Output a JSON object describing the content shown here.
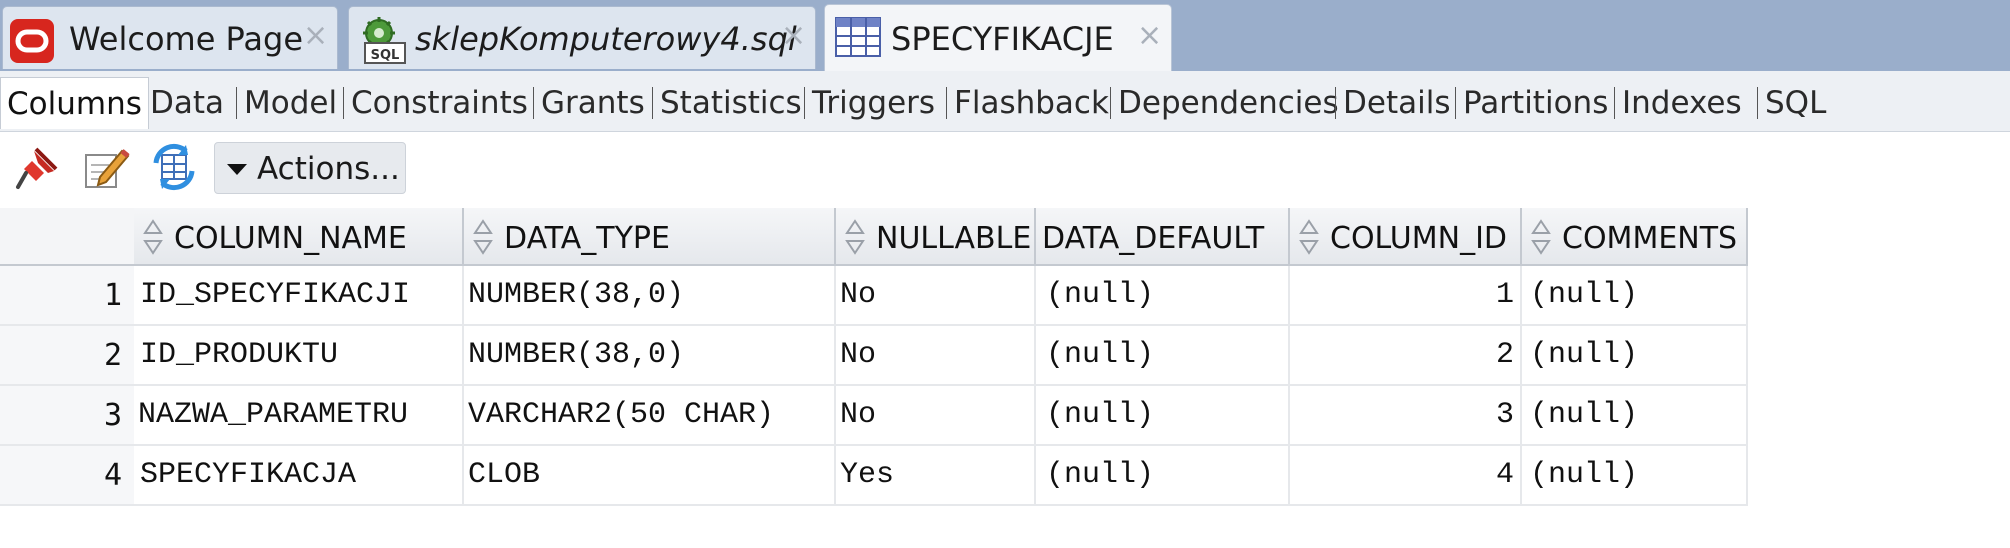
{
  "tabs": [
    {
      "label": "Welcome Page",
      "icon": "oracle-logo-icon",
      "italic": false
    },
    {
      "label": "sklepKomputerowy4.sql",
      "icon": "sql-file-icon",
      "italic": true
    },
    {
      "label": "SPECYFIKACJE",
      "icon": "table-icon",
      "italic": false,
      "active": true
    }
  ],
  "tab_close_glyph": "×",
  "subtabs": [
    "Columns",
    "Data",
    "Model",
    "Constraints",
    "Grants",
    "Statistics",
    "Triggers",
    "Flashback",
    "Dependencies",
    "Details",
    "Partitions",
    "Indexes",
    "SQL"
  ],
  "active_subtab": "Columns",
  "toolbar": {
    "icons": [
      "pin-icon",
      "edit-icon",
      "refresh-icon"
    ],
    "actions_label": "Actions..."
  },
  "grid": {
    "columns": [
      "COLUMN_NAME",
      "DATA_TYPE",
      "NULLABLE",
      "DATA_DEFAULT",
      "COLUMN_ID",
      "COMMENTS"
    ],
    "rows": [
      {
        "num": "1",
        "COLUMN_NAME": "ID_SPECYFIKACJI",
        "DATA_TYPE": "NUMBER(38,0)",
        "NULLABLE": "No",
        "DATA_DEFAULT": "(null)",
        "COLUMN_ID": "1",
        "COMMENTS": "(null)"
      },
      {
        "num": "2",
        "COLUMN_NAME": "ID_PRODUKTU",
        "DATA_TYPE": "NUMBER(38,0)",
        "NULLABLE": "No",
        "DATA_DEFAULT": "(null)",
        "COLUMN_ID": "2",
        "COMMENTS": "(null)"
      },
      {
        "num": "3",
        "COLUMN_NAME": "NAZWA_PARAMETRU",
        "DATA_TYPE": "VARCHAR2(50 CHAR)",
        "NULLABLE": "No",
        "DATA_DEFAULT": "(null)",
        "COLUMN_ID": "3",
        "COMMENTS": "(null)"
      },
      {
        "num": "4",
        "COLUMN_NAME": "SPECYFIKACJA",
        "DATA_TYPE": "CLOB",
        "NULLABLE": "Yes",
        "DATA_DEFAULT": "(null)",
        "COLUMN_ID": "4",
        "COMMENTS": "(null)"
      }
    ]
  },
  "colors": {
    "tab_strip": "#9aaecb",
    "oracle_red": "#d7261e",
    "header_bg": "#e9ecef"
  }
}
